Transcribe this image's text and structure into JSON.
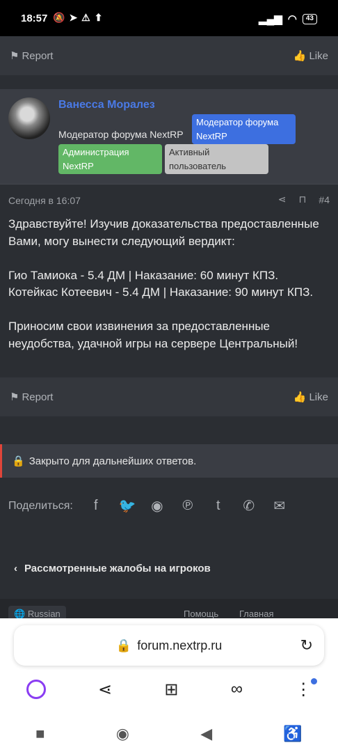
{
  "status_bar": {
    "time": "18:57",
    "battery": "43"
  },
  "post_prev": {
    "report": "Report",
    "like": "Like"
  },
  "author": {
    "name": "Ванесса Моралез",
    "title": "Модератор форума NextRP",
    "badges": {
      "moderator": "Модератор форума NextRP",
      "admin": "Администрация NextRP",
      "active": "Активный пользователь"
    }
  },
  "post": {
    "date": "Сегодня в 16:07",
    "number": "#4",
    "p1": "Здравствуйте! Изучив доказательства предоставленные Вами, могу вынести следующий вердикт:",
    "p2a": "Гио Тамиока - 5.4 ДМ | Наказание: 60 минут КПЗ.",
    "p2b": "Котейкас Котеевич - 5.4 ДМ | Наказание: 90 минут КПЗ.",
    "p3": "Приносим свои извинения за предоставленные неудобства, удачной игры на сервере Центральный!",
    "report": "Report",
    "like": "Like"
  },
  "closed": "Закрыто для дальнейших ответов.",
  "share": {
    "label": "Поделиться:"
  },
  "breadcrumb": "Рассмотренные жалобы на игроков",
  "footer": {
    "lang": "Russian",
    "help": "Помощь",
    "home": "Главная"
  },
  "browser": {
    "url": "forum.nextrp.ru"
  },
  "colors": {
    "accent": "#3d6fe0",
    "admin": "#62b766",
    "closed": "#e0453a"
  }
}
